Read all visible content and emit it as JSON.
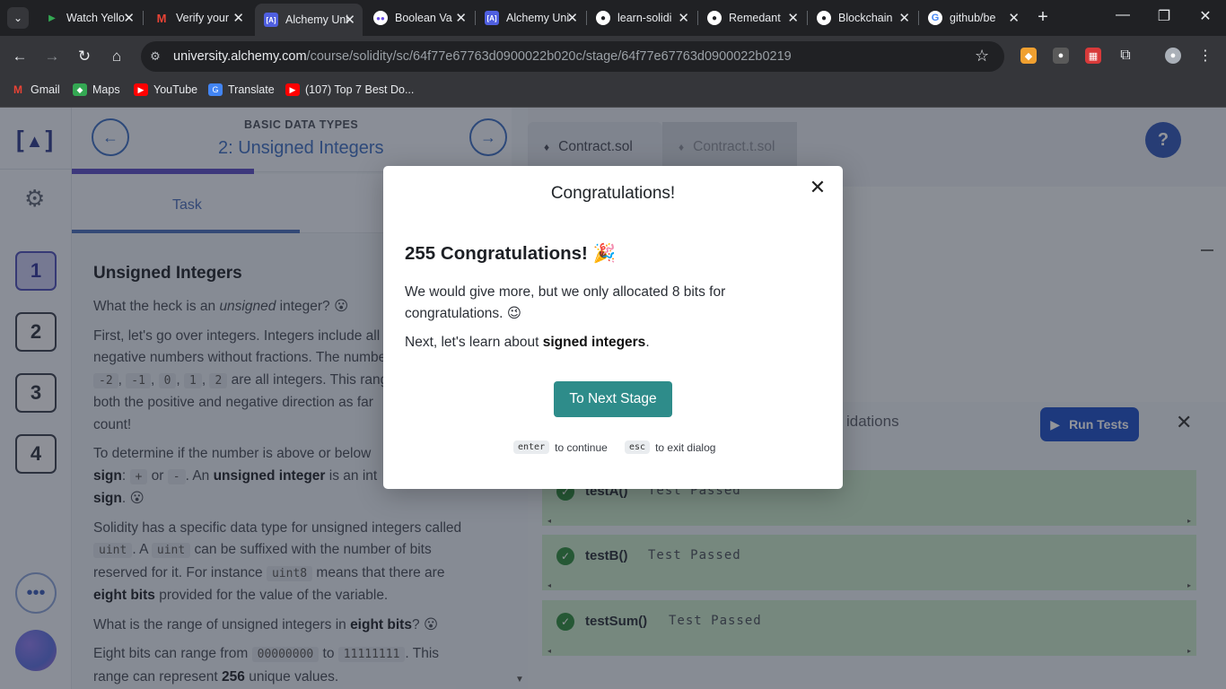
{
  "browser": {
    "tabs": [
      {
        "title": "Watch Yello",
        "icon": "play-icon",
        "color": "#34a853"
      },
      {
        "title": "Verify your",
        "icon": "gmail-icon",
        "color": "#ea4335"
      },
      {
        "title": "Alchemy Uni",
        "icon": "alchemy-icon",
        "color": "#4f5fe0"
      },
      {
        "title": "Boolean Va",
        "icon": "chat-bubble-icon",
        "color": "#6b4de6"
      },
      {
        "title": "Alchemy Uni",
        "icon": "alchemy-icon",
        "color": "#4f5fe0"
      },
      {
        "title": "learn-solidi",
        "icon": "github-icon",
        "color": "#ffffff"
      },
      {
        "title": "Remedant",
        "icon": "github-icon",
        "color": "#ffffff"
      },
      {
        "title": "Blockchain",
        "icon": "github-icon",
        "color": "#ffffff"
      },
      {
        "title": "github/be",
        "icon": "google-icon",
        "color": "#4285f4"
      }
    ],
    "url_host": "university.alchemy.com",
    "url_path": "/course/solidity/sc/64f77e67763d0900022b020c/stage/64f77e67763d0900022b0219",
    "bookmarks": [
      "Gmail",
      "Maps",
      "YouTube",
      "Translate",
      "(107) Top 7 Best Do..."
    ]
  },
  "lesson": {
    "category": "BASIC DATA TYPES",
    "title": "2: Unsigned Integers",
    "task_tab": "Task",
    "stages": [
      "1",
      "2",
      "3",
      "4"
    ],
    "heading": "Unsigned Integers",
    "p1_a": "What the heck is an ",
    "p1_em": "unsigned",
    "p1_b": " integer? 😮",
    "p2_a": "First, let's go over integers. Integers include all",
    "p2_b": "negative numbers without fractions. The numbers",
    "p2_codes": [
      "-2",
      "-1",
      "0",
      "1",
      "2"
    ],
    "p2_c": " are all integers. This range",
    "p2_d": "both the positive and negative direction as far",
    "p2_e": "count!",
    "p3_a": "To determine if the number is above or below",
    "p3_b": "sign",
    "p3_c": ": ",
    "p3_plus": "+",
    "p3_or": " or ",
    "p3_minus": "-",
    "p3_d": ". An ",
    "p3_e": "unsigned integer",
    "p3_f": " is an int",
    "p3_g": "sign",
    "p3_h": ". 😮",
    "p4_a": "Solidity has a specific data type for unsigned integers called",
    "p4_code1": "uint",
    "p4_b": ". A ",
    "p4_code2": "uint",
    "p4_c": " can be suffixed with the number of bits",
    "p4_d": "reserved for it. For instance ",
    "p4_code3": "uint8",
    "p4_e": " means that there are",
    "p4_f": "eight bits",
    "p4_g": " provided for the value of the variable.",
    "p5_a": "What is the range of unsigned integers in ",
    "p5_b": "eight bits",
    "p5_c": "? 😮",
    "p6_a": "Eight bits can range from ",
    "p6_code1": "00000000",
    "p6_b": " to ",
    "p6_code2": "11111111",
    "p6_c": ". This",
    "p6_d": "range can represent ",
    "p6_e": "256",
    "p6_f": " unique values."
  },
  "editor": {
    "tab_active": "Contract.sol",
    "tab_inactive": "Contract.t.sol",
    "help": "?",
    "validations_label": "idations",
    "run_tests": "Run Tests",
    "tests": [
      {
        "name": "testA()",
        "status": "Test Passed"
      },
      {
        "name": "testB()",
        "status": "Test Passed"
      },
      {
        "name": "testSum()",
        "status": "Test Passed"
      }
    ]
  },
  "dialog": {
    "title": "Congratulations!",
    "heading": "255 Congratulations! 🎉",
    "line1": "We would give more, but we only allocated 8 bits for",
    "line2": "congratulations. 😉",
    "line3_a": "Next, let's learn about ",
    "line3_b": "signed integers",
    "line3_c": ".",
    "button": "To Next Stage",
    "hint_enter_key": "enter",
    "hint_enter_text": "to continue",
    "hint_esc_key": "esc",
    "hint_esc_text": "to exit dialog"
  },
  "colors": {
    "accent_teal": "#2e8c8a",
    "pass_green": "#c7e6c9",
    "primary_blue": "#1e4fc7"
  }
}
